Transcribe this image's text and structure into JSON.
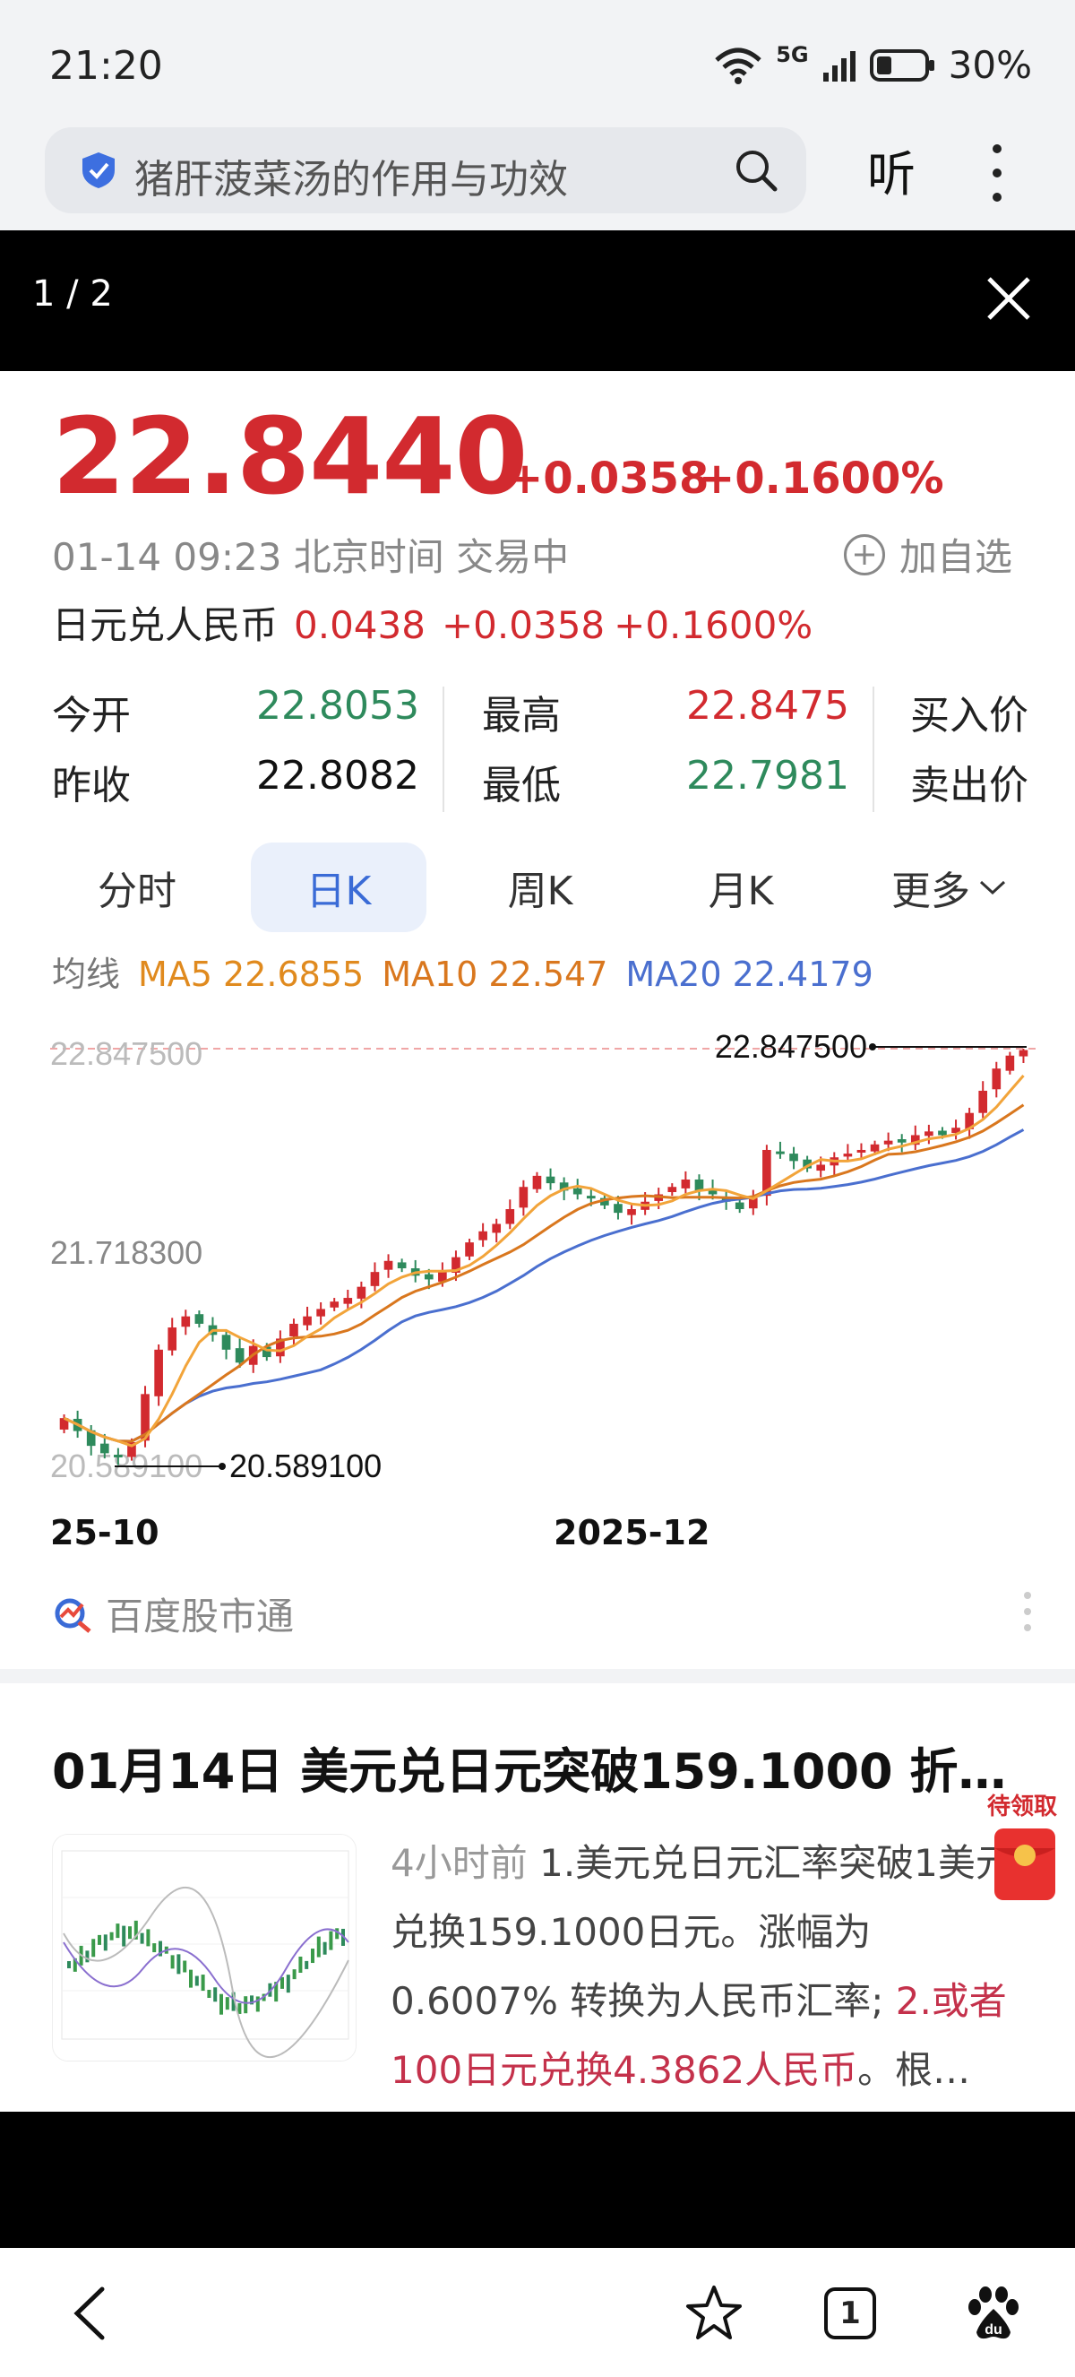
{
  "status_bar": {
    "time": "21:20",
    "network": "5G",
    "battery": "30%",
    "icons": [
      "wifi-icon",
      "signal-icon",
      "battery-icon"
    ]
  },
  "search": {
    "query": "猪肝菠菜汤的作用与功效",
    "listen_label": "听"
  },
  "viewer": {
    "counter": "1 / 2"
  },
  "quote": {
    "price": "22.8440",
    "change": "+0.0358",
    "change_pct": "+0.1600%",
    "meta": "01-14 09:23  北京时间  交易中",
    "add_watch": "加自选",
    "pair_name": "日元兑人民币",
    "pair_value": "0.0438",
    "pair_change": "+0.0358",
    "pair_change_pct": "+0.1600%",
    "open_label": "今开",
    "open_value": "22.8053",
    "prev_close_label": "昨收",
    "prev_close_value": "22.8082",
    "high_label": "最高",
    "high_value": "22.8475",
    "low_label": "最低",
    "low_value": "22.7981",
    "buy_label": "买入价",
    "sell_label": "卖出价"
  },
  "tabs": [
    "分时",
    "日K",
    "周K",
    "月K",
    "更多"
  ],
  "active_tab": "日K",
  "ma": {
    "label": "均线",
    "ma5": "MA5 22.6855",
    "ma10": "MA10 22.547",
    "ma20": "MA20 22.4179"
  },
  "colors": {
    "up": "#d22a2f",
    "down": "#2e8a5c",
    "ma5": "#e08a1e",
    "ma10": "#d9771e",
    "ma20": "#4a6fcf",
    "accent": "#3a6bd6"
  },
  "chart_data": {
    "type": "candlestick",
    "y_tick_labels": [
      "22.847500",
      "21.718300",
      "20.589100"
    ],
    "ylim": [
      20.5891,
      22.8475
    ],
    "max_marker": "22.847500",
    "min_marker": "20.589100",
    "x_tick_labels": [
      "25-10",
      "2025-12"
    ],
    "close_series": [
      20.85,
      20.78,
      20.7,
      20.66,
      20.64,
      20.72,
      20.98,
      21.22,
      21.34,
      21.4,
      21.36,
      21.3,
      21.22,
      21.15,
      21.24,
      21.18,
      21.28,
      21.36,
      21.4,
      21.44,
      21.48,
      21.5,
      21.56,
      21.64,
      21.7,
      21.66,
      21.62,
      21.6,
      21.64,
      21.72,
      21.8,
      21.86,
      21.9,
      21.98,
      22.1,
      22.16,
      22.12,
      22.08,
      22.06,
      22.04,
      22.0,
      21.96,
      21.98,
      22.02,
      22.06,
      22.1,
      22.14,
      22.08,
      22.06,
      22.02,
      21.98,
      22.04,
      22.3,
      22.28,
      22.24,
      22.2,
      22.22,
      22.26,
      22.28,
      22.3,
      22.33,
      22.35,
      22.34,
      22.38,
      22.4,
      22.38,
      22.42,
      22.5,
      22.62,
      22.74,
      22.81,
      22.84
    ],
    "ma5_end": 22.6855,
    "ma10_end": 22.547,
    "ma20_end": 22.4179
  },
  "source": {
    "label": "百度股市通"
  },
  "news": {
    "title": "01月14日 美元兑日元突破159.1000 折…",
    "time": "4小时前",
    "body1": "1.美元兑日元汇率突破1美元兑换159.1000日元。涨幅为0.6007% 转换为人民币汇率; ",
    "body_highlight": "2.或者100日元兑换4.3862人民币",
    "body2": "。根…",
    "red_packet_label": "待领取"
  },
  "bottom_nav": {
    "tab_count": "1",
    "icons": [
      "back-icon",
      "star-icon",
      "tabs-icon",
      "baidu-paw-icon"
    ]
  }
}
